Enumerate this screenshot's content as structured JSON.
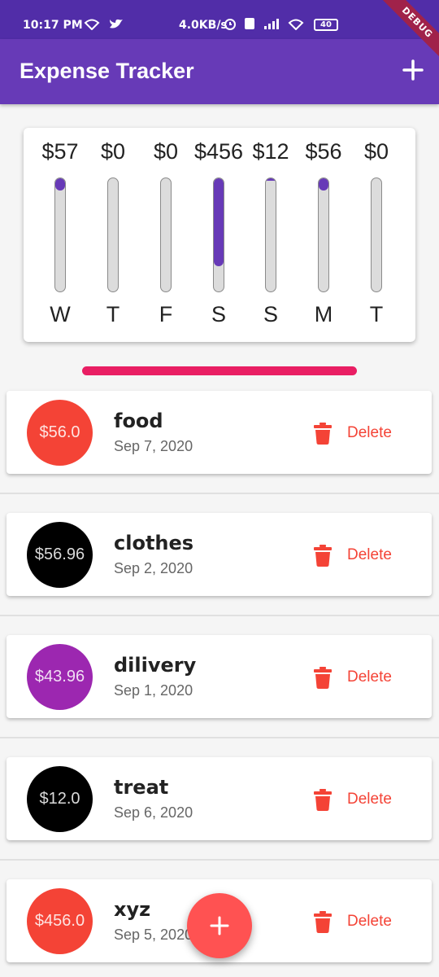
{
  "status_bar": {
    "time": "10:17 PM",
    "network_speed": "4.0KB/s",
    "battery": "40",
    "debug_banner": "DEBUG"
  },
  "app_bar": {
    "title": "Expense Tracker",
    "add_icon": "plus-icon"
  },
  "chart_data": {
    "type": "bar",
    "categories": [
      "W",
      "T",
      "F",
      "S",
      "S",
      "M",
      "T"
    ],
    "value_labels": [
      "$57",
      "$0",
      "$0",
      "$456",
      "$12",
      "$56",
      "$0"
    ],
    "values": [
      57,
      0,
      0,
      456,
      12,
      56,
      0
    ],
    "fill_fraction": [
      0.11,
      0,
      0,
      0.78,
      0.02,
      0.11,
      0
    ],
    "bar_color": "#673ab7",
    "track_color": "#dcdcdc"
  },
  "transactions": [
    {
      "amount": "$56.0",
      "title": "food",
      "date": "Sep 7, 2020",
      "delete_label": "Delete",
      "avatar_color": "#f44336"
    },
    {
      "amount": "$56.96",
      "title": "clothes",
      "date": "Sep 2, 2020",
      "delete_label": "Delete",
      "avatar_color": "#000000"
    },
    {
      "amount": "$43.96",
      "title": "dilivery",
      "date": "Sep 1, 2020",
      "delete_label": "Delete",
      "avatar_color": "#9c27b0"
    },
    {
      "amount": "$12.0",
      "title": "treat",
      "date": "Sep 6, 2020",
      "delete_label": "Delete",
      "avatar_color": "#000000"
    },
    {
      "amount": "$456.0",
      "title": "xyz",
      "date": "Sep 5, 2020",
      "delete_label": "Delete",
      "avatar_color": "#f44336"
    }
  ],
  "fab": {
    "icon": "plus-icon"
  },
  "colors": {
    "primary": "#673ab7",
    "accent": "#e91e63",
    "delete": "#f44336",
    "fab": "#ff5252"
  }
}
